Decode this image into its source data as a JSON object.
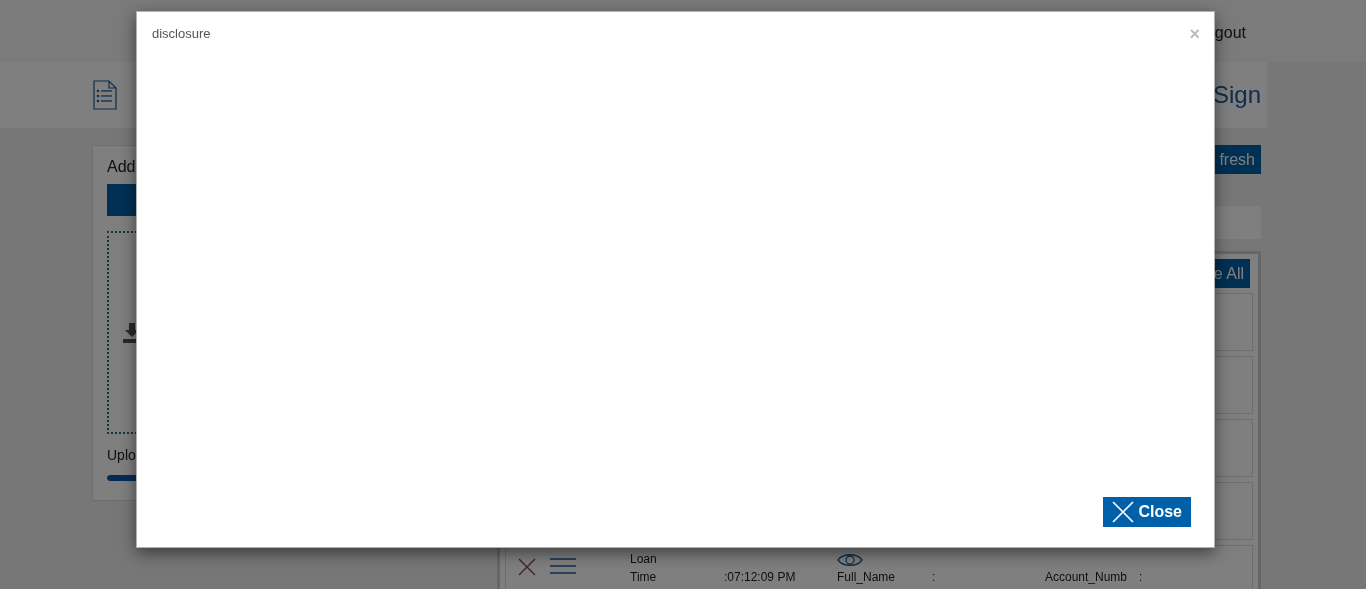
{
  "top_bar": {
    "logout_link": "gout"
  },
  "header": {
    "title": "Sign"
  },
  "upload_card": {
    "title": "Add",
    "status_label": "Uplo",
    "progress": {
      "level": 1
    }
  },
  "documents": {
    "refresh_button": "fresh",
    "select_all_button": "e All",
    "cards": [
      {
        "kind": "blank"
      },
      {
        "kind": "blank"
      },
      {
        "kind": "blank"
      },
      {
        "kind": "blank"
      },
      {
        "kind": "document",
        "type": "Loan",
        "fields": [
          {
            "label": "Time",
            "value": ":07:12:09 PM"
          },
          {
            "label": "Full_Name",
            "value": ":"
          },
          {
            "label": "Account_Numb",
            "value": ":"
          }
        ]
      }
    ]
  },
  "dialog": {
    "title": "disclosure",
    "close_icon": "×",
    "close_button": "Close"
  }
}
